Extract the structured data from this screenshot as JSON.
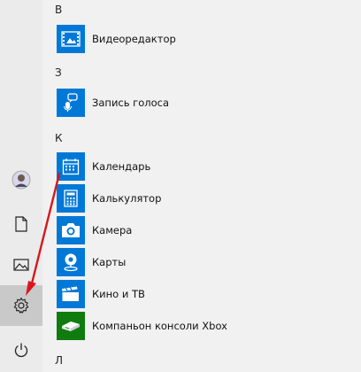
{
  "rail": {
    "items": [
      {
        "icon": "user-avatar-icon"
      },
      {
        "icon": "documents-icon"
      },
      {
        "icon": "pictures-icon"
      },
      {
        "icon": "settings-gear-icon",
        "active": true
      },
      {
        "icon": "power-icon"
      }
    ]
  },
  "groups": [
    {
      "letter": "В",
      "apps": [
        {
          "label": "Видеоредактор",
          "icon": "video-editor-icon",
          "color": "#0078d7"
        }
      ]
    },
    {
      "letter": "З",
      "apps": [
        {
          "label": "Запись голоса",
          "icon": "microphone-icon",
          "color": "#0078d7"
        }
      ]
    },
    {
      "letter": "К",
      "apps": [
        {
          "label": "Календарь",
          "icon": "calendar-icon",
          "color": "#0078d7"
        },
        {
          "label": "Калькулятор",
          "icon": "calculator-icon",
          "color": "#0078d7"
        },
        {
          "label": "Камера",
          "icon": "camera-icon",
          "color": "#0078d7"
        },
        {
          "label": "Карты",
          "icon": "maps-icon",
          "color": "#0078d7"
        },
        {
          "label": "Кино и ТВ",
          "icon": "movies-tv-icon",
          "color": "#0078d7"
        },
        {
          "label": "Компаньон консоли Xbox",
          "icon": "xbox-console-icon",
          "color": "#107c10"
        }
      ]
    },
    {
      "letter": "Л",
      "apps": []
    }
  ],
  "annotation": {
    "color": "#d9161c"
  }
}
